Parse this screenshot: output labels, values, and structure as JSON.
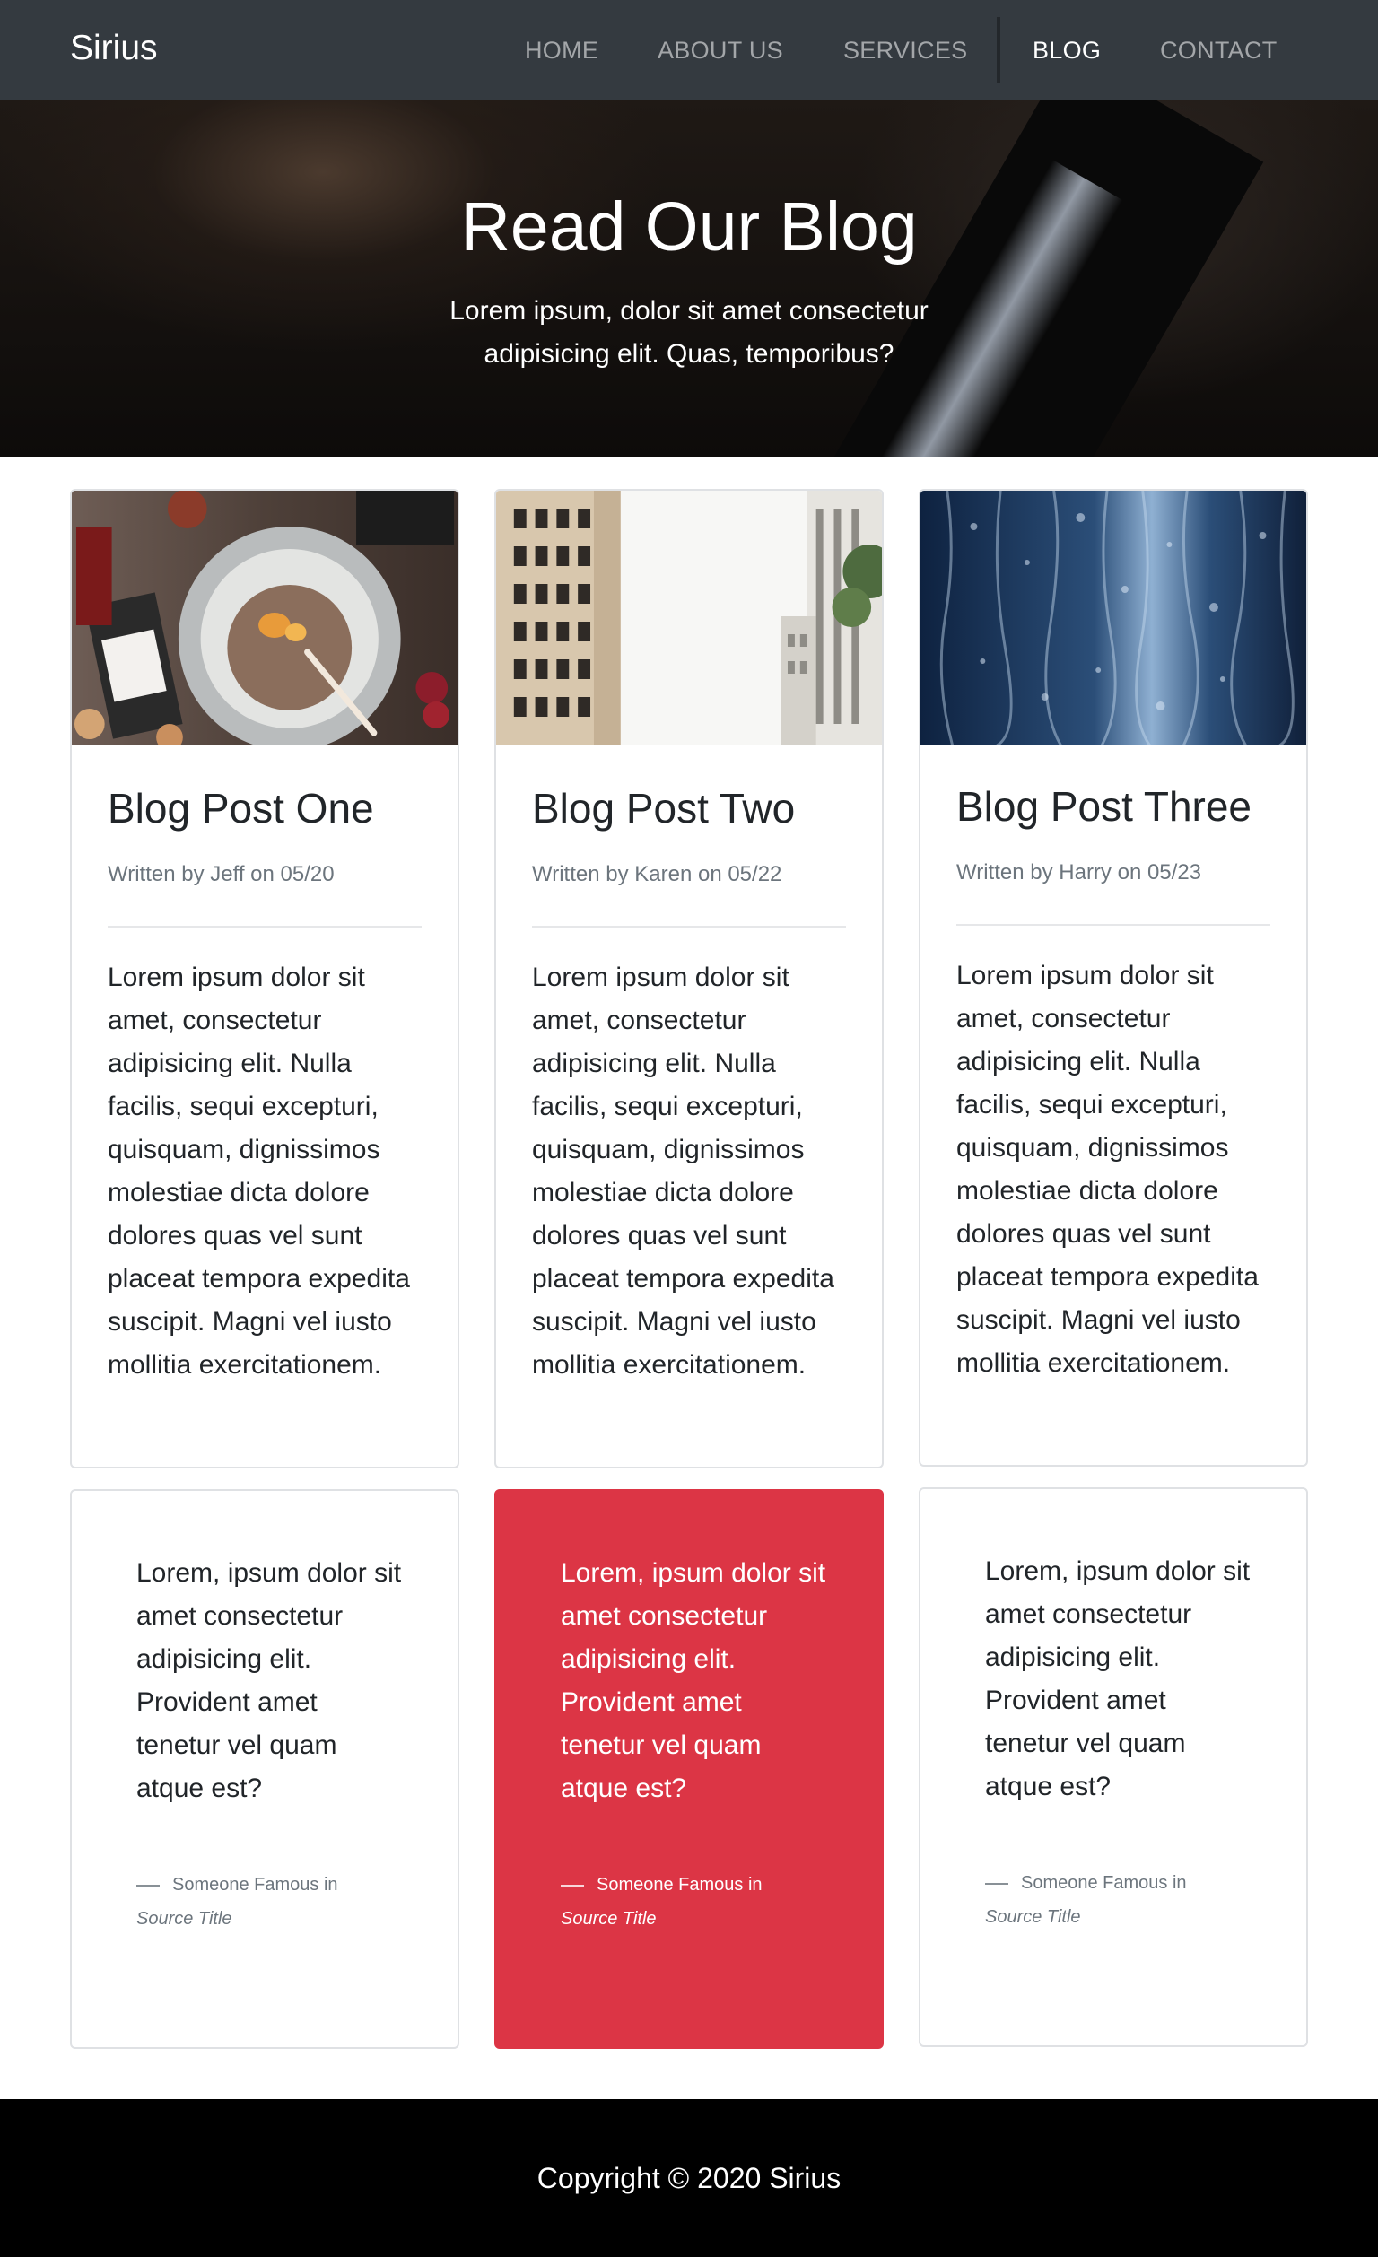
{
  "nav": {
    "brand": "Sirius",
    "items": [
      {
        "label": "HOME",
        "active": false
      },
      {
        "label": "ABOUT US",
        "active": false
      },
      {
        "label": "SERVICES",
        "active": false
      },
      {
        "label": "BLOG",
        "active": true
      },
      {
        "label": "CONTACT",
        "active": false
      }
    ]
  },
  "hero": {
    "title": "Read Our Blog",
    "subtitle": "Lorem ipsum, dolor sit amet consectetur adipisicing elit. Quas, temporibus?"
  },
  "posts": [
    {
      "image_icon": "baking-bowl-image",
      "title": "Blog Post One",
      "meta": "Written by Jeff on 05/20",
      "body": "Lorem ipsum dolor sit amet, consectetur adipisicing elit. Nulla facilis, sequi excepturi, quisquam, dignissimos molestiae dicta dolore dolores quas vel sunt placeat tempora expedita suscipit. Magni vel iusto mollitia exercitationem."
    },
    {
      "image_icon": "city-buildings-image",
      "title": "Blog Post Two",
      "meta": "Written by Karen on 05/22",
      "body": "Lorem ipsum dolor sit amet, consectetur adipisicing elit. Nulla facilis, sequi excepturi, quisquam, dignissimos molestiae dicta dolore dolores quas vel sunt placeat tempora expedita suscipit. Magni vel iusto mollitia exercitationem."
    },
    {
      "image_icon": "rain-window-image",
      "title": "Blog Post Three",
      "meta": "Written by Harry on 05/23",
      "body": "Lorem ipsum dolor sit amet, consectetur adipisicing elit. Nulla facilis, sequi excepturi, quisquam, dignissimos molestiae dicta dolore dolores quas vel sunt placeat tempora expedita suscipit. Magni vel iusto mollitia exercitationem."
    }
  ],
  "quotes": [
    {
      "text": "Lorem, ipsum dolor sit amet consectetur adipisicing elit. Provident amet tenetur vel quam atque est?",
      "author": "Someone Famous in",
      "source": "Source Title"
    },
    {
      "text": "Lorem, ipsum dolor sit amet consectetur adipisicing elit. Provident amet tenetur vel quam atque est?",
      "author": "Someone Famous in",
      "source": "Source Title"
    },
    {
      "text": "Lorem, ipsum dolor sit amet consectetur adipisicing elit. Provident amet tenetur vel quam atque est?",
      "author": "Someone Famous in",
      "source": "Source Title"
    }
  ],
  "footer": {
    "copyright": "Copyright © 2020 Sirius"
  },
  "colors": {
    "navbar": "#343a40",
    "accent_red": "#dc3545",
    "footer": "#000000",
    "muted_text": "#6c757d"
  }
}
